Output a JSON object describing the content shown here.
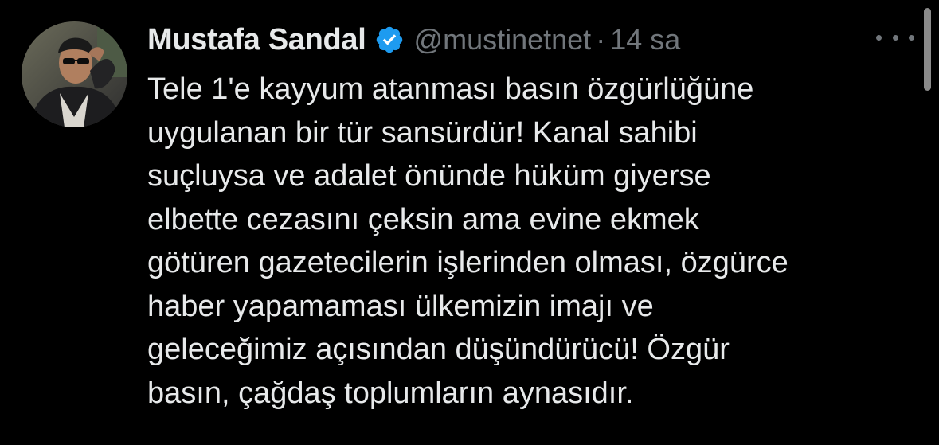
{
  "tweet": {
    "author": {
      "display_name": "Mustafa Sandal",
      "handle": "@mustinetnet",
      "verified_icon": "verified-badge-icon",
      "avatar_icon": "avatar"
    },
    "separator": "·",
    "time": "14 sa",
    "more_icon": "more-options-icon",
    "text_lines": [
      "Tele 1'e kayyum atanması basın özgürlüğüne",
      "uygulanan bir tür sansürdür! Kanal sahibi",
      "suçluysa ve adalet önünde hüküm giyerse",
      "elbette cezasını çeksin ama evine ekmek",
      "götüren gazetecilerin işlerinden olması, özgürce",
      "haber yapamaması ülkemizin imajı ve",
      "geleceğimiz açısından düşündürücü! Özgür",
      "basın, çağdaş toplumların aynasıdır."
    ]
  },
  "colors": {
    "background": "#000000",
    "primary_text": "#e7e9ea",
    "secondary_text": "#71767b",
    "verified_blue": "#1d9bf0"
  }
}
